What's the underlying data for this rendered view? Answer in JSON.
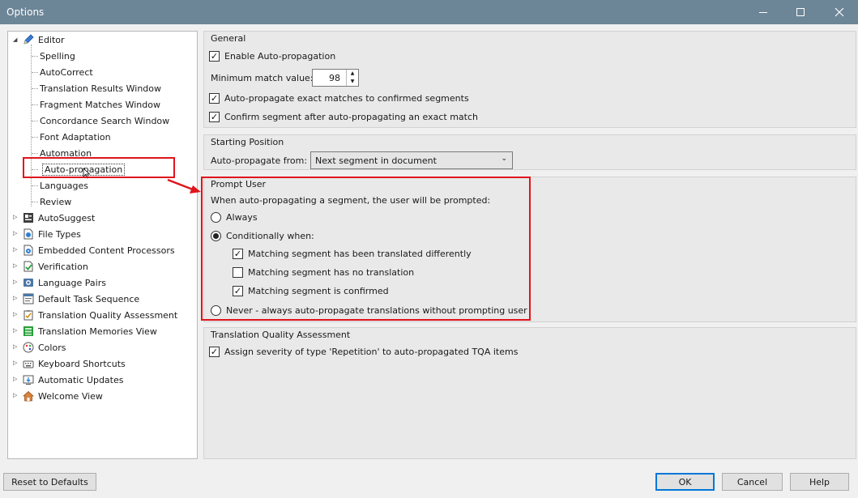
{
  "window": {
    "title": "Options"
  },
  "tree": {
    "editor": {
      "label": "Editor",
      "children": [
        "Spelling",
        "AutoCorrect",
        "Translation Results Window",
        "Fragment Matches Window",
        "Concordance Search Window",
        "Font Adaptation",
        "Automation",
        "Auto-propagation",
        "Languages",
        "Review"
      ]
    },
    "items": [
      "AutoSuggest",
      "File Types",
      "Embedded Content Processors",
      "Verification",
      "Language Pairs",
      "Default Task Sequence",
      "Translation Quality Assessment",
      "Translation Memories View",
      "Colors",
      "Keyboard Shortcuts",
      "Automatic Updates",
      "Welcome View"
    ]
  },
  "general": {
    "title": "General",
    "enable_label": "Enable Auto-propagation",
    "min_match_label": "Minimum match value:",
    "min_match_value": "98",
    "exact_label": "Auto-propagate exact matches to confirmed segments",
    "confirm_label": "Confirm segment after auto-propagating an exact match"
  },
  "starting": {
    "title": "Starting Position",
    "from_label": "Auto-propagate from:",
    "from_value": "Next segment in document"
  },
  "prompt": {
    "title": "Prompt User",
    "description": "When auto-propagating a segment, the user will be prompted:",
    "always": "Always",
    "conditional": "Conditionally when:",
    "cond_translated": "Matching segment has been translated differently",
    "cond_no_translation": "Matching segment has no translation",
    "cond_confirmed": "Matching segment is confirmed",
    "never": "Never - always auto-propagate translations without prompting user"
  },
  "tqa": {
    "title": "Translation Quality Assessment",
    "assign_label": "Assign severity of type 'Repetition' to auto-propagated TQA items"
  },
  "buttons": {
    "reset": "Reset to Defaults",
    "ok": "OK",
    "cancel": "Cancel",
    "help": "Help"
  },
  "colors": {
    "titlebar": "#6c8597",
    "highlight": "#e0151c"
  }
}
